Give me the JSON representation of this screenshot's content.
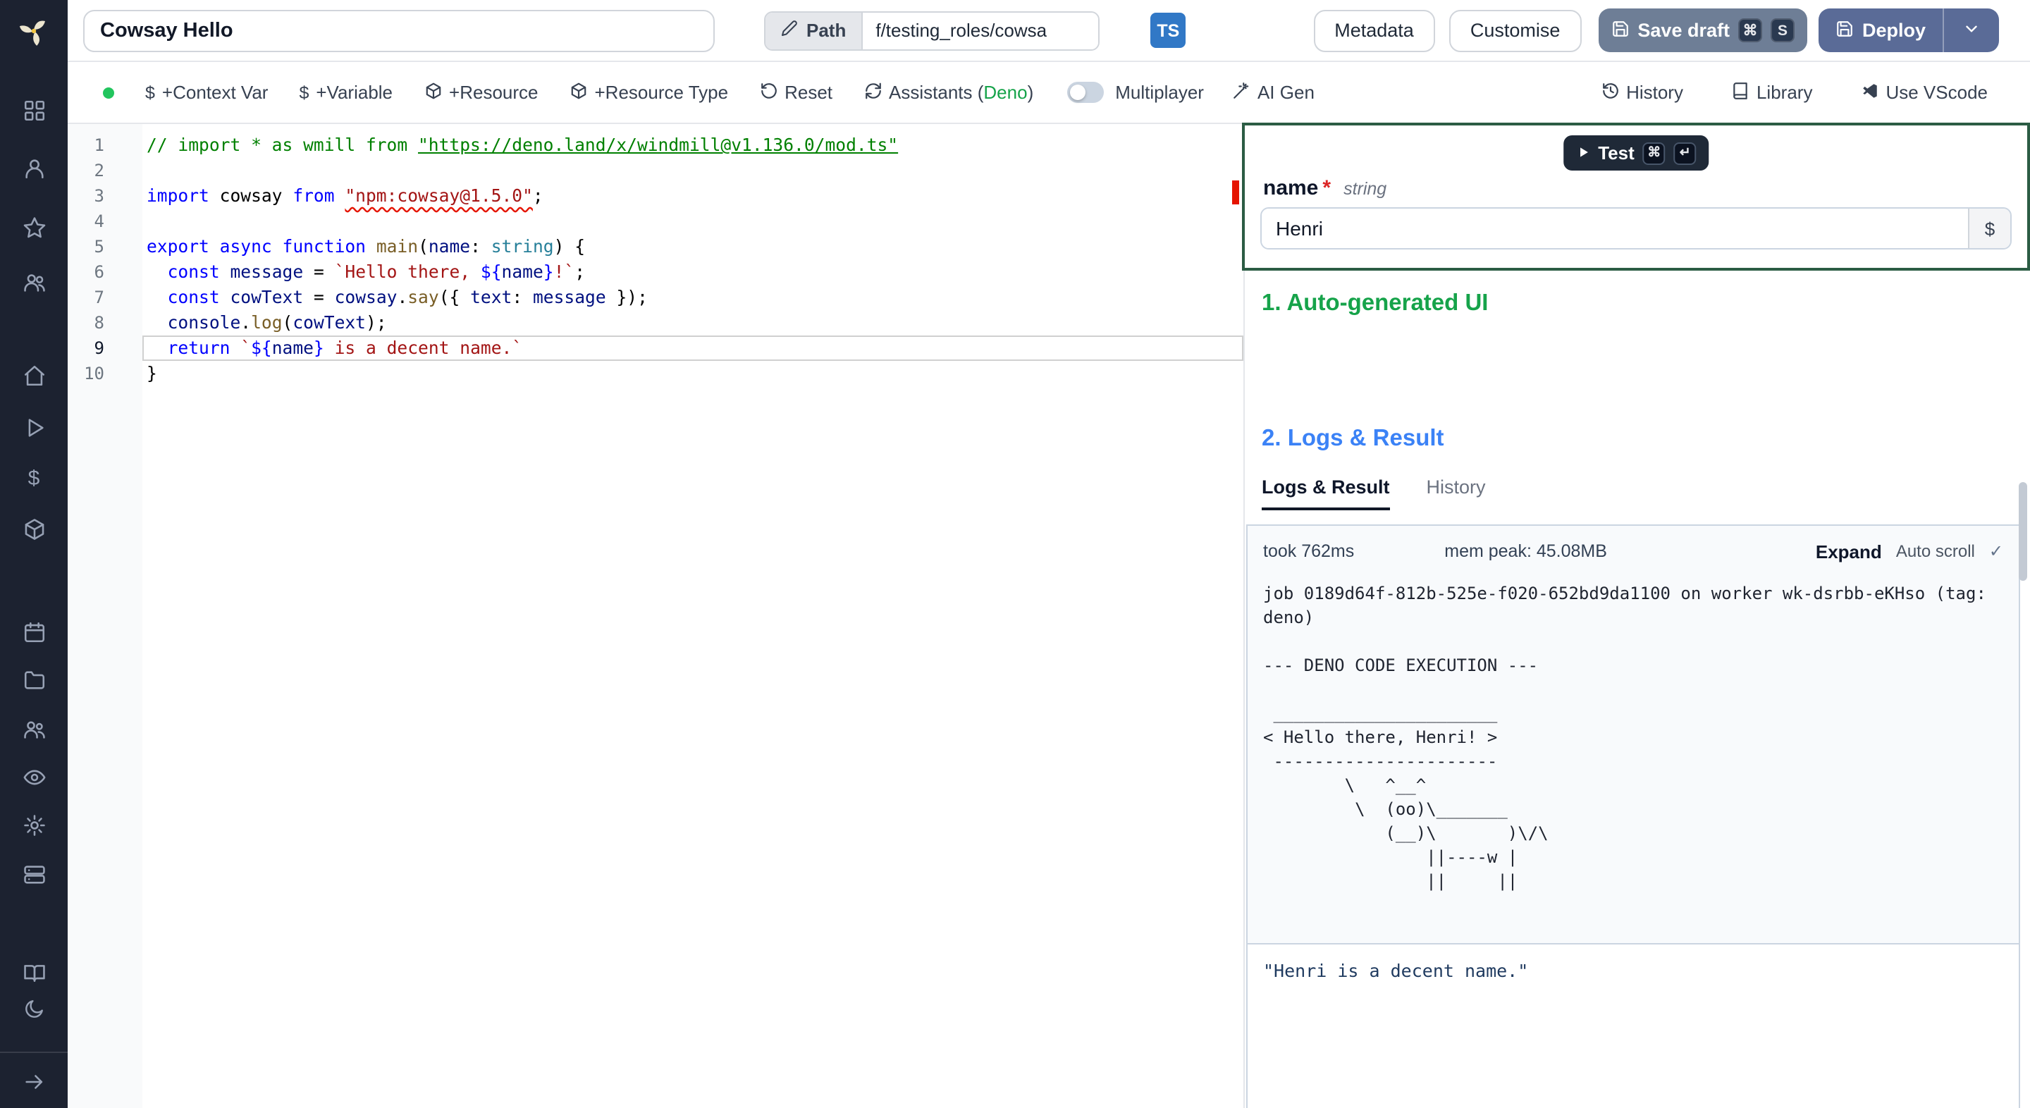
{
  "topbar": {
    "script_name": "Cowsay Hello",
    "path_label": "Path",
    "path_value": "f/testing_roles/cowsa",
    "lang_badge": "TS",
    "metadata": "Metadata",
    "customise": "Customise",
    "save_draft": "Save draft",
    "save_kbd_1": "⌘",
    "save_kbd_2": "S",
    "deploy": "Deploy"
  },
  "toolbar": {
    "dollar": "$",
    "context_var": "+Context Var",
    "variable": "+Variable",
    "resource": "+Resource",
    "resource_type": "+Resource Type",
    "reset": "Reset",
    "assistants_prefix": "Assistants (",
    "assistants_lang": "Deno",
    "assistants_suffix": ")",
    "multiplayer": "Multiplayer",
    "ai_gen": "AI Gen",
    "history": "History",
    "library": "Library",
    "use_vscode": "Use VScode"
  },
  "editor": {
    "lines": [
      {
        "n": "1",
        "tokens": [
          [
            "cmt",
            "// import * as wmill from "
          ],
          [
            "cmt-link",
            "\"https://deno.land/x/windmill@v1.136.0/mod.ts\""
          ]
        ]
      },
      {
        "n": "2",
        "tokens": []
      },
      {
        "n": "3",
        "tokens": [
          [
            "kw",
            "import"
          ],
          [
            "pln",
            " cowsay "
          ],
          [
            "kw",
            "from"
          ],
          [
            "pln",
            " "
          ],
          [
            "str-err",
            "\"npm:cowsay@1.5.0\""
          ],
          [
            "pln",
            ";"
          ]
        ]
      },
      {
        "n": "4",
        "tokens": []
      },
      {
        "n": "5",
        "tokens": [
          [
            "kw",
            "export"
          ],
          [
            "pln",
            " "
          ],
          [
            "kw",
            "async"
          ],
          [
            "pln",
            " "
          ],
          [
            "kw",
            "function"
          ],
          [
            "pln",
            " "
          ],
          [
            "fn",
            "main"
          ],
          [
            "pln",
            "("
          ],
          [
            "var",
            "name"
          ],
          [
            "pln",
            ": "
          ],
          [
            "type",
            "string"
          ],
          [
            "pln",
            ") {"
          ]
        ]
      },
      {
        "n": "6",
        "tokens": [
          [
            "pln",
            "  "
          ],
          [
            "kw",
            "const"
          ],
          [
            "pln",
            " "
          ],
          [
            "var",
            "message"
          ],
          [
            "pln",
            " = "
          ],
          [
            "str",
            "`Hello there, "
          ],
          [
            "delim",
            "${"
          ],
          [
            "var",
            "name"
          ],
          [
            "delim",
            "}"
          ],
          [
            "str",
            "!`"
          ],
          [
            "pln",
            ";"
          ]
        ]
      },
      {
        "n": "7",
        "tokens": [
          [
            "pln",
            "  "
          ],
          [
            "kw",
            "const"
          ],
          [
            "pln",
            " "
          ],
          [
            "var",
            "cowText"
          ],
          [
            "pln",
            " = "
          ],
          [
            "var",
            "cowsay"
          ],
          [
            "pln",
            "."
          ],
          [
            "fn",
            "say"
          ],
          [
            "pln",
            "({ "
          ],
          [
            "var",
            "text"
          ],
          [
            "pln",
            ": "
          ],
          [
            "var",
            "message"
          ],
          [
            "pln",
            " });"
          ]
        ]
      },
      {
        "n": "8",
        "tokens": [
          [
            "pln",
            "  "
          ],
          [
            "var",
            "console"
          ],
          [
            "pln",
            "."
          ],
          [
            "fn",
            "log"
          ],
          [
            "pln",
            "("
          ],
          [
            "var",
            "cowText"
          ],
          [
            "pln",
            ");"
          ]
        ]
      },
      {
        "n": "9",
        "active": true,
        "tokens": [
          [
            "pln",
            "  "
          ],
          [
            "kw",
            "return"
          ],
          [
            "pln",
            " "
          ],
          [
            "str",
            "`"
          ],
          [
            "delim",
            "${"
          ],
          [
            "var",
            "name"
          ],
          [
            "delim",
            "}"
          ],
          [
            "str",
            " is a decent name.`"
          ]
        ]
      },
      {
        "n": "10",
        "tokens": [
          [
            "pln",
            "}"
          ]
        ]
      }
    ]
  },
  "form": {
    "test": "Test",
    "kbd_1": "⌘",
    "kbd_2": "↵",
    "field_name": "name",
    "required": "*",
    "field_type": "string",
    "field_value": "Henri",
    "dollar": "$"
  },
  "sections": {
    "auto_ui": "1. Auto-generated UI",
    "logs_result": "2. Logs & Result"
  },
  "logs": {
    "tab_logs": "Logs & Result",
    "tab_history": "History",
    "took": "took 762ms",
    "mem": "mem peak: 45.08MB",
    "expand": "Expand",
    "autoscroll": "Auto scroll",
    "check": "✓",
    "text": "job 0189d64f-812b-525e-f020-652bd9da1100 on worker wk-dsrbb-eKHso (tag: deno)\n\n--- DENO CODE EXECUTION ---\n\n ______________________\n< Hello there, Henri! >\n ----------------------\n        \\   ^__^\n         \\  (oo)\\_______\n            (__)\\       )\\/\\\n                ||----w |\n                ||     ||",
    "result": "\"Henri is a decent name.\""
  }
}
